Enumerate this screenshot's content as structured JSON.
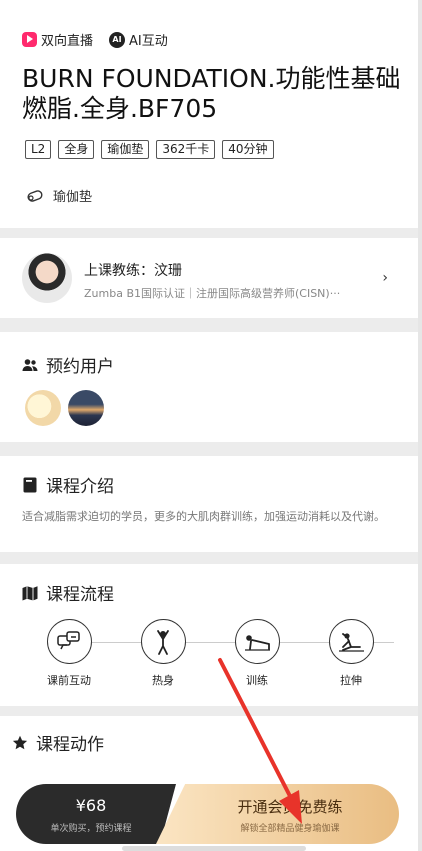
{
  "header": {
    "tag_live": "双向直播",
    "tag_ai": "AI互动",
    "tag_ai_badge": "AI",
    "title": "BURN FOUNDATION.功能性基础燃脂.全身.BF705",
    "chips": [
      "L2",
      "全身",
      "瑜伽垫",
      "362千卡",
      "40分钟"
    ],
    "equipment": "瑜伽垫"
  },
  "coach": {
    "name": "上课教练：汶珊",
    "desc": "Zumba B1国际认证｜注册国际高级营养师(CISN)···"
  },
  "users": {
    "title": "预约用户"
  },
  "intro": {
    "title": "课程介绍",
    "text": "适合减脂需求迫切的学员，更多的大肌肉群训练，加强运动消耗以及代谢。"
  },
  "flow": {
    "title": "课程流程",
    "steps": [
      {
        "label": "课前互动",
        "icon": "chat-icon"
      },
      {
        "label": "热身",
        "icon": "warmup-icon"
      },
      {
        "label": "训练",
        "icon": "plank-icon"
      },
      {
        "label": "拉伸",
        "icon": "stretch-icon"
      }
    ]
  },
  "moves": {
    "title": "课程动作"
  },
  "purchase": {
    "price": "¥68",
    "price_sub": "单次购买，预约课程",
    "vip": "开通会员免费练",
    "vip_sub": "解锁全部精品健身瑜伽课"
  },
  "colors": {
    "accent": "#ff2a6d",
    "arrow": "#e8332a",
    "gold": "#e9bd82"
  }
}
